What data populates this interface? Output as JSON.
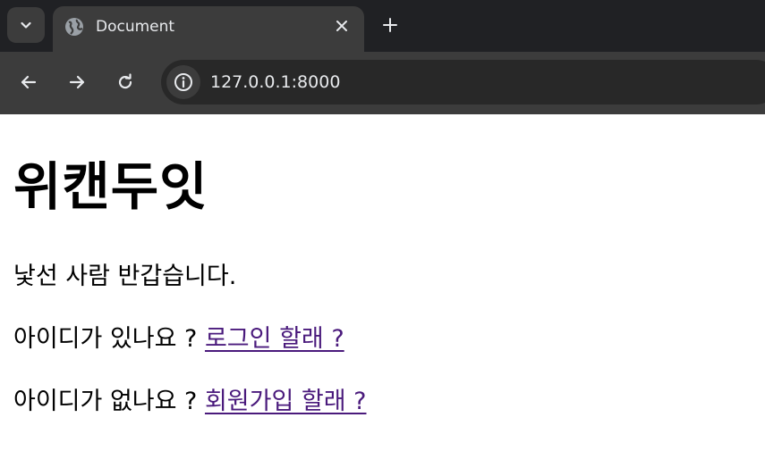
{
  "browser": {
    "tab": {
      "title": "Document",
      "favicon": "globe-icon"
    },
    "toolbar": {
      "url": "127.0.0.1:8000"
    },
    "colors": {
      "tabstrip_bg": "#202124",
      "toolbar_bg": "#3c3c3c",
      "omnibox_bg": "#282828",
      "link_visited": "#4a1a7c"
    }
  },
  "page": {
    "title": "위캔두잇",
    "greeting": "낯선 사람 반갑습니다.",
    "login_prompt": {
      "text": "아이디가 있나요 ? ",
      "link_label": "로그인 할래 ?"
    },
    "signup_prompt": {
      "text": "아이디가 없나요 ? ",
      "link_label": "회원가입 할래 ?"
    }
  }
}
